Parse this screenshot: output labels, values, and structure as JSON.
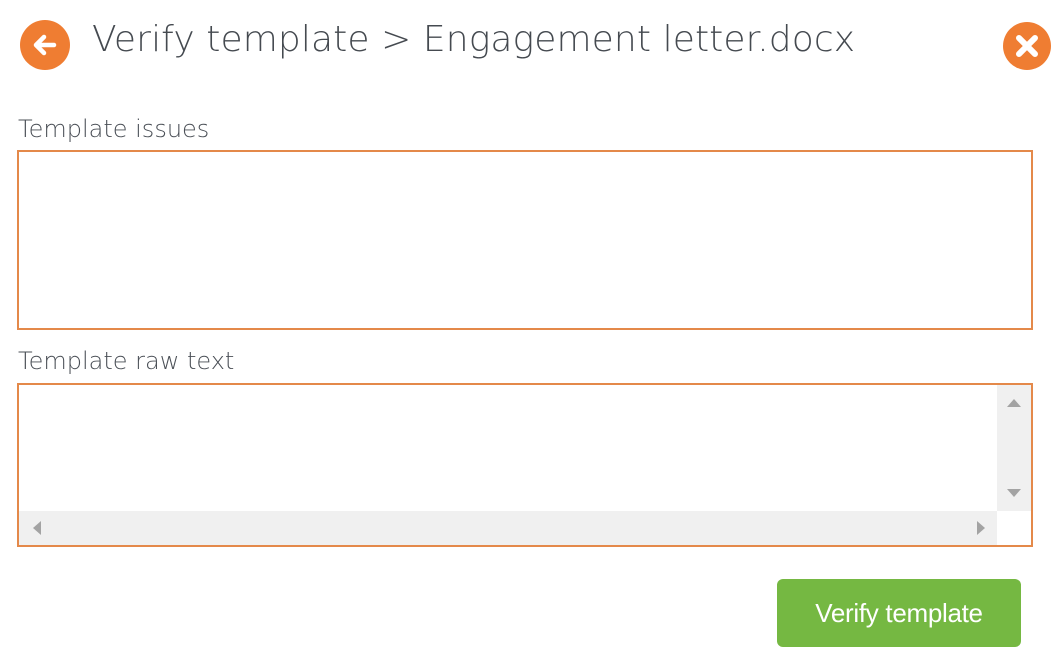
{
  "header": {
    "title": "Verify template > Engagement letter.docx",
    "back_icon": "arrow-left-circle-icon",
    "close_icon": "close-circle-icon"
  },
  "issues": {
    "label": "Template issues",
    "value": ""
  },
  "raw_text": {
    "label": "Template raw text",
    "value": ""
  },
  "actions": {
    "verify_label": "Verify template"
  },
  "colors": {
    "accent": "#ef7d32",
    "border": "#e4894a",
    "primary_button": "#75b842",
    "scrollbar": "#f0f0f0"
  }
}
